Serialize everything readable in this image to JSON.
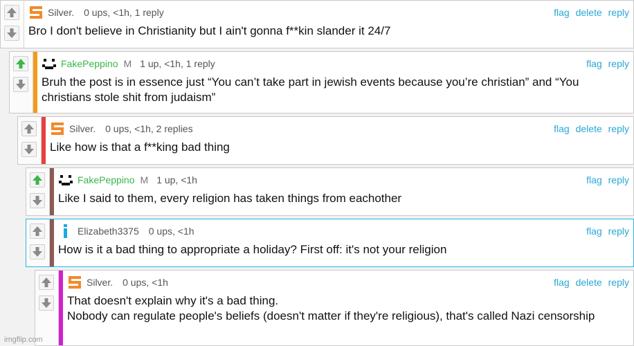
{
  "actions": {
    "flag": "flag",
    "delete": "delete",
    "reply": "reply"
  },
  "comments": [
    {
      "username": "Silver.",
      "badge": "",
      "stats": "0 ups, <1h, 1 reply",
      "avatar": "silver-logo-icon",
      "text": "Bro I don't believe in Christianity but I ain't gonna f**kin slander it 24/7",
      "upvoted": false,
      "deletable": true
    },
    {
      "username": "FakePeppino",
      "badge": "M",
      "stats": "1 up, <1h, 1 reply",
      "avatar": "pixel-face-icon",
      "text": "Bruh the post is in essence just “You can’t take part in jewish events because you’re christian” and “You christians stole shit from judaism”",
      "upvoted": true,
      "deletable": false,
      "stripe": "#f39a1c"
    },
    {
      "username": "Silver.",
      "badge": "",
      "stats": "0 ups, <1h, 2 replies",
      "avatar": "silver-logo-icon",
      "text": "Like how is that a f**king bad thing",
      "upvoted": false,
      "deletable": true,
      "stripe": "#e6413d"
    },
    {
      "username": "FakePeppino",
      "badge": "M",
      "stats": "1 up, <1h",
      "avatar": "pixel-face-icon",
      "text": "Like I said to them, every religion has taken things from eachother",
      "upvoted": true,
      "deletable": false,
      "stripe": "#8c5a52"
    },
    {
      "username": "Elizabeth3375",
      "badge": "",
      "stats": "0 ups, <1h",
      "avatar": "info-icon",
      "text": "How is it a bad thing to appropriate a holiday? First off: it's not your religion",
      "upvoted": false,
      "deletable": false,
      "stripe": "#8c5a52"
    },
    {
      "username": "Silver.",
      "badge": "",
      "stats": "0 ups, <1h",
      "avatar": "silver-logo-icon",
      "text": "That doesn't explain why it's a bad thing.\nNobody can regulate people's beliefs (doesn't matter if they're religious), that's called Nazi censorship",
      "upvoted": false,
      "deletable": true,
      "stripe": "#d21fd2"
    }
  ],
  "watermark": "imgflip.com"
}
